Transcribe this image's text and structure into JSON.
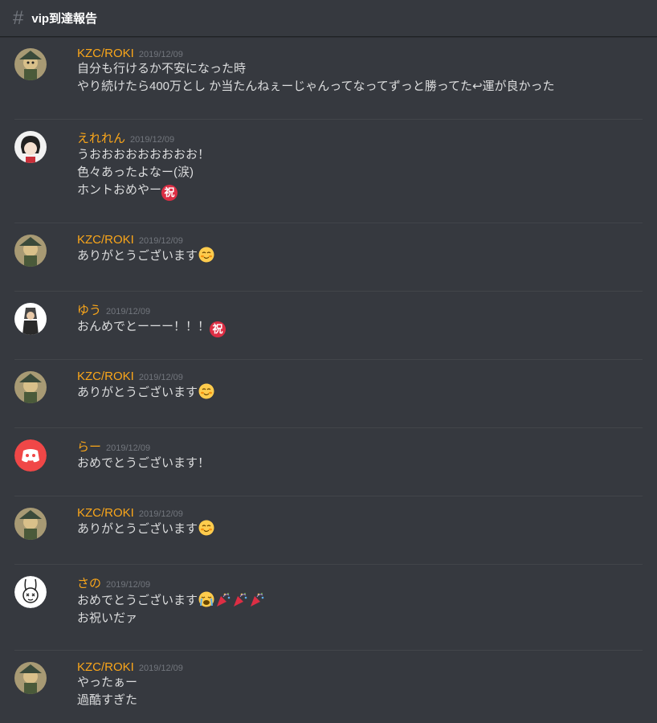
{
  "channel": {
    "name": "vip到達報告"
  },
  "messages": [
    {
      "author": "KZC/ROKI",
      "time": "2019/12/09",
      "avatar": "roki-avatar",
      "lines": [
        "自分も行けるか不安になった時",
        "やり続けたら400万とし か当たんねぇーじゃんってなってずっと勝ってた↩運が良かった"
      ]
    },
    {
      "author": "えれれん",
      "time": "2019/12/09",
      "avatar": "ereren-avatar",
      "lines": [
        "うおおおおおおおおお！",
        "色々あったよなー(涙)",
        "ホントおめやー"
      ]
    },
    {
      "author": "KZC/ROKI",
      "time": "2019/12/09",
      "avatar": "roki-avatar",
      "lines": [
        "ありがとうございます"
      ]
    },
    {
      "author": "ゆう",
      "time": "2019/12/09",
      "avatar": "yuu-avatar",
      "lines": [
        "おんめでとーーー！！！"
      ]
    },
    {
      "author": "KZC/ROKI",
      "time": "2019/12/09",
      "avatar": "roki-avatar",
      "lines": [
        "ありがとうございます"
      ]
    },
    {
      "author": "らー",
      "time": "2019/12/09",
      "avatar": "discord-default-avatar",
      "lines": [
        "おめでとうございます！"
      ]
    },
    {
      "author": "KZC/ROKI",
      "time": "2019/12/09",
      "avatar": "roki-avatar",
      "lines": [
        "ありがとうございます"
      ]
    },
    {
      "author": "さの",
      "time": "2019/12/09",
      "avatar": "rabbit-avatar",
      "lines": [
        "おめでとうございます",
        "お祝いだァ"
      ]
    },
    {
      "author": "KZC/ROKI",
      "time": "2019/12/09",
      "avatar": "roki-avatar",
      "lines": [
        "やったぁー",
        "過酷すぎた"
      ]
    }
  ],
  "emojis": {
    "iwai": "祝",
    "blush": "blush-emoji",
    "cry": "crying-emoji",
    "party": "party-popper-emoji"
  },
  "colors": {
    "background": "#36393f",
    "author": "#faa61a",
    "text": "#dcddde",
    "timestamp": "#72767d"
  }
}
